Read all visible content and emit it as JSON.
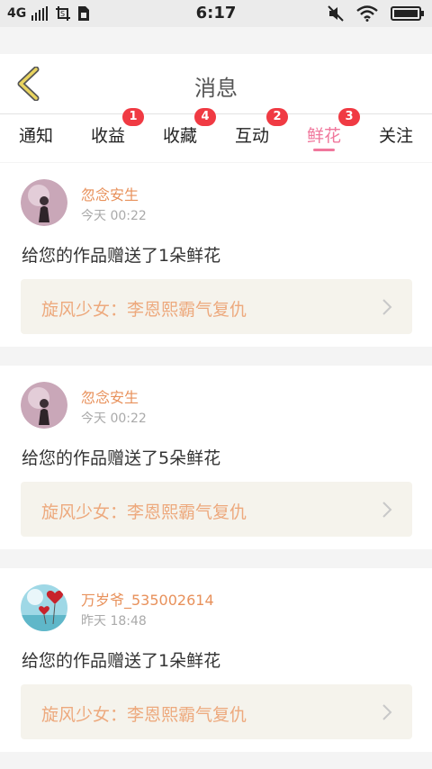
{
  "status_bar": {
    "network": "4G",
    "time": "6:17",
    "icons": [
      "signal-icon",
      "screenshot-icon",
      "sim-icon",
      "mute-icon",
      "wifi-icon",
      "battery-icon"
    ]
  },
  "header": {
    "title": "消息",
    "back_icon": "chevron-left-icon"
  },
  "tabs": [
    {
      "label": "通知",
      "badge": "",
      "active": false
    },
    {
      "label": "收益",
      "badge": "1",
      "active": false
    },
    {
      "label": "收藏",
      "badge": "4",
      "active": false
    },
    {
      "label": "互动",
      "badge": "2",
      "active": false
    },
    {
      "label": "鲜花",
      "badge": "3",
      "active": true
    },
    {
      "label": "关注",
      "badge": "",
      "active": false
    }
  ],
  "messages": [
    {
      "user": "忽念安生",
      "time": "今天 00:22",
      "text": "给您的作品赠送了1朵鲜花",
      "work": "旋风少女：李恩熙霸气复仇"
    },
    {
      "user": "忽念安生",
      "time": "今天 00:22",
      "text": "给您的作品赠送了5朵鲜花",
      "work": "旋风少女：李恩熙霸气复仇"
    },
    {
      "user": "万岁爷_535002614",
      "time": "昨天 18:48",
      "text": "给您的作品赠送了1朵鲜花",
      "work": "旋风少女：李恩熙霸气复仇"
    }
  ],
  "colors": {
    "accent": "#f0779c",
    "username": "#e8915b",
    "work_title": "#eda97d",
    "badge": "#f03a43",
    "back_icon": "#e9d45f"
  }
}
